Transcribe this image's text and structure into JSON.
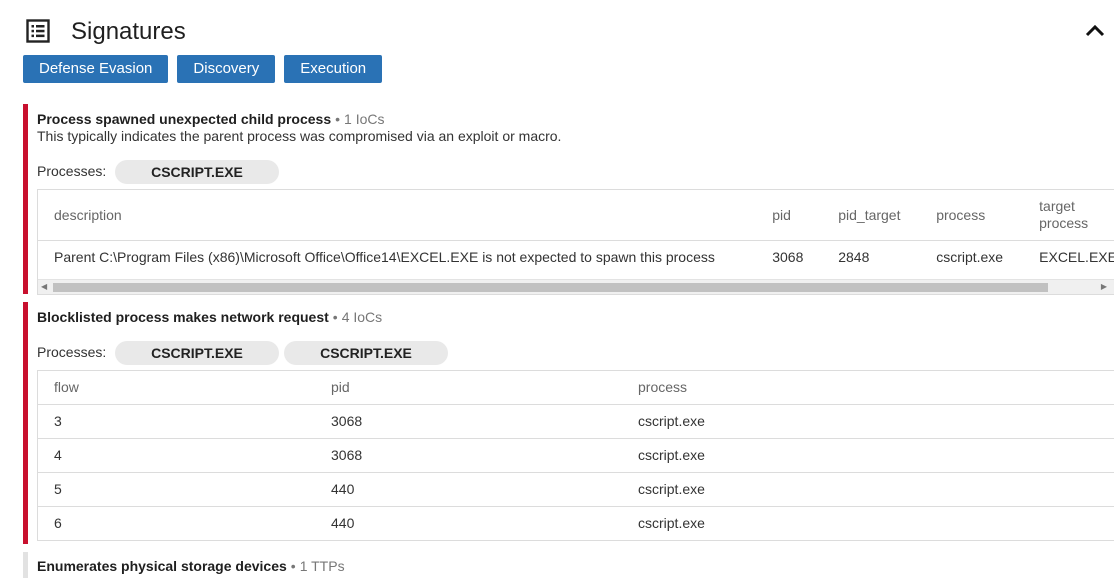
{
  "header": {
    "title": "Signatures"
  },
  "tags": [
    "Defense Evasion",
    "Discovery",
    "Execution"
  ],
  "signatures": [
    {
      "name": "Process spawned unexpected child process",
      "count": "1 IoCs",
      "description": "This typically indicates the parent process was compromised via an exploit or macro.",
      "processes_label": "Processes:",
      "processes": [
        "CSCRIPT.EXE"
      ],
      "columns": [
        "description",
        "pid",
        "pid_target",
        "process",
        "target process"
      ],
      "rows": [
        [
          "Parent C:\\Program Files (x86)\\Microsoft Office\\Office14\\EXCEL.EXE is not expected to spawn this process",
          "3068",
          "2848",
          "cscript.exe",
          "EXCEL.EXE"
        ]
      ]
    },
    {
      "name": "Blocklisted process makes network request",
      "count": "4 IoCs",
      "processes_label": "Processes:",
      "processes": [
        "CSCRIPT.EXE",
        "CSCRIPT.EXE"
      ],
      "columns": [
        "flow",
        "pid",
        "process"
      ],
      "rows": [
        [
          "3",
          "3068",
          "cscript.exe"
        ],
        [
          "4",
          "3068",
          "cscript.exe"
        ],
        [
          "5",
          "440",
          "cscript.exe"
        ],
        [
          "6",
          "440",
          "cscript.exe"
        ]
      ]
    },
    {
      "name": "Enumerates physical storage devices",
      "count": "1 TTPs"
    }
  ]
}
